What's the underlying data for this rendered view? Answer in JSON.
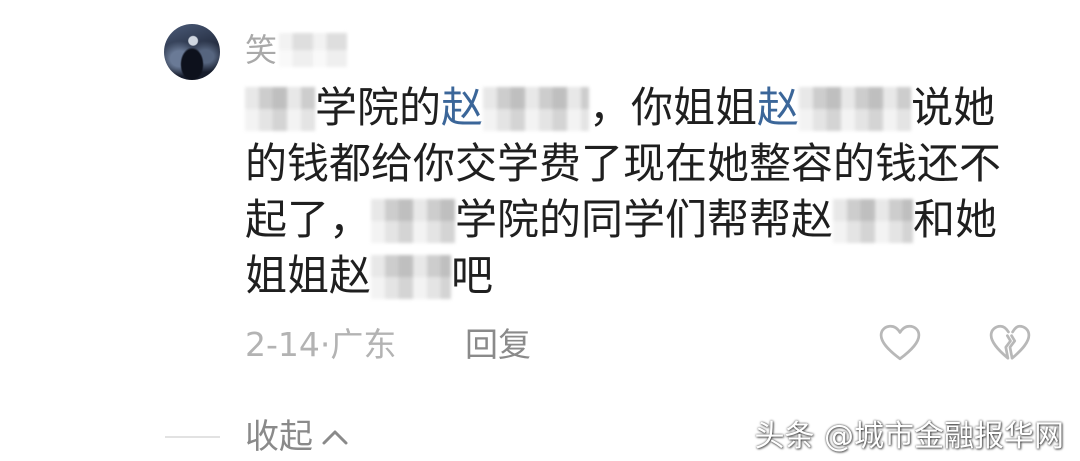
{
  "comment": {
    "avatar_icon": "user-avatar",
    "username": "笑",
    "lines": [
      [
        "学院的",
        "赵",
        "，你姐姐",
        "赵",
        "说她"
      ],
      [
        "的钱都给你交学费了现在她整容的钱还不"
      ],
      [
        "起了，",
        "学院的同学们帮帮赵",
        "和她"
      ],
      [
        "姐姐赵",
        "吧"
      ]
    ],
    "meta": {
      "date_location": "2-14·广东",
      "reply_label": "回复"
    },
    "actions": {
      "like_icon": "heart-outline-icon",
      "dislike_icon": "broken-heart-icon"
    }
  },
  "collapse": {
    "label": "收起",
    "icon": "chevron-up-icon"
  },
  "watermark": "头条 @城市金融报华网",
  "colors": {
    "text": "#1f1f1f",
    "mention": "#3b6699",
    "username": "#a9a9a9",
    "meta": "#b3b3b3",
    "action_text": "#8a8a8a",
    "icon_stroke": "#b8b8b8",
    "background": "#ffffff"
  }
}
